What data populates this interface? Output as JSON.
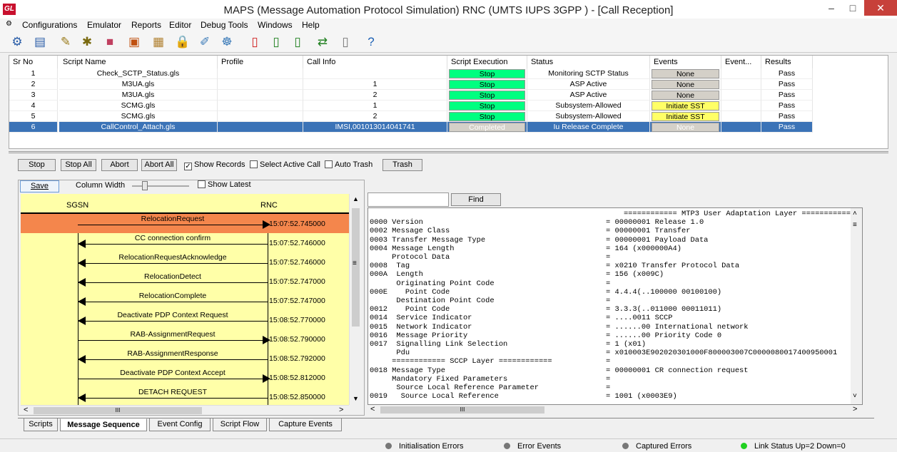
{
  "window": {
    "title": "MAPS (Message Automation Protocol Simulation) RNC (UMTS IUPS 3GPP ) - [Call Reception]",
    "logo": "GL",
    "minimize": "–",
    "maximize": "□",
    "close": "✕"
  },
  "menu": [
    "Configurations",
    "Emulator",
    "Reports",
    "Editor",
    "Debug Tools",
    "Windows",
    "Help"
  ],
  "mdi": [
    "_",
    "🗗",
    "×"
  ],
  "grid": {
    "headers": [
      "Sr No",
      "Script Name",
      "Profile",
      "Call Info",
      "Script Execution",
      "Status",
      "Events",
      "Event...",
      "Results"
    ],
    "rows": [
      {
        "sr": "1",
        "script": "Check_SCTP_Status.gls",
        "profile": "",
        "call": "",
        "exec": "Stop",
        "status": "Monitoring SCTP Status",
        "events": "None",
        "ev2": "",
        "result": "Pass"
      },
      {
        "sr": "2",
        "script": "M3UA.gls",
        "profile": "",
        "call": "1",
        "exec": "Stop",
        "status": "ASP Active",
        "events": "None",
        "ev2": "",
        "result": "Pass"
      },
      {
        "sr": "3",
        "script": "M3UA.gls",
        "profile": "",
        "call": "2",
        "exec": "Stop",
        "status": "ASP Active",
        "events": "None",
        "ev2": "",
        "result": "Pass"
      },
      {
        "sr": "4",
        "script": "SCMG.gls",
        "profile": "",
        "call": "1",
        "exec": "Stop",
        "status": "Subsystem-Allowed",
        "events": "Initiate SST",
        "ev2": "",
        "result": "Pass"
      },
      {
        "sr": "5",
        "script": "SCMG.gls",
        "profile": "",
        "call": "2",
        "exec": "Stop",
        "status": "Subsystem-Allowed",
        "events": "Initiate SST",
        "ev2": "",
        "result": "Pass"
      },
      {
        "sr": "6",
        "script": "CallControl_Attach.gls",
        "profile": "",
        "call": "IMSI,001013014041741",
        "exec": "Completed",
        "status": "Iu Release Complete",
        "events": "None",
        "ev2": "",
        "result": "Pass"
      }
    ]
  },
  "controls": {
    "stop": "Stop",
    "stop_all": "Stop All",
    "abort": "Abort",
    "abort_all": "Abort All",
    "show_records": "Show Records",
    "select_active": "Select Active Call",
    "auto_trash": "Auto Trash",
    "trash": "Trash",
    "check": "✓"
  },
  "seq": {
    "save": "Save",
    "column_width": "Column Width",
    "show_latest": "Show Latest",
    "left": "SGSN",
    "right": "RNC",
    "hscroll": "III",
    "messages": [
      {
        "label": "RelocationRequest",
        "dir": "right",
        "time": "15:07:52.745000",
        "hl": true
      },
      {
        "label": "CC connection confirm",
        "dir": "left",
        "time": "15:07:52.746000"
      },
      {
        "label": "RelocationRequestAcknowledge",
        "dir": "left",
        "time": "15:07:52.746000"
      },
      {
        "label": "RelocationDetect",
        "dir": "left",
        "time": "15:07:52.747000"
      },
      {
        "label": "RelocationComplete",
        "dir": "left",
        "time": "15:07:52.747000"
      },
      {
        "label": "Deactivate PDP Context Request",
        "dir": "left",
        "time": "15:08:52.770000"
      },
      {
        "label": "RAB-AssignmentRequest",
        "dir": "right",
        "time": "15:08:52.790000"
      },
      {
        "label": "RAB-AssignmentResponse",
        "dir": "left",
        "time": "15:08:52.792000"
      },
      {
        "label": "Deactivate PDP Context Accept",
        "dir": "right",
        "time": "15:08:52.812000"
      },
      {
        "label": "DETACH REQUEST",
        "dir": "left",
        "time": "15:08:52.850000"
      }
    ]
  },
  "decode": {
    "find": "Find",
    "search": "",
    "hscroll": "III",
    "lines": [
      [
        "",
        "    ============ MTP3 User Adaptation Layer ============ ="
      ],
      [
        "0000 Version",
        "= 00000001 Release 1.0"
      ],
      [
        "0002 Message Class",
        "= 00000001 Transfer"
      ],
      [
        "0003 Transfer Message Type",
        "= 00000001 Payload Data"
      ],
      [
        "0004 Message Length",
        "= 164 (x000000A4)"
      ],
      [
        "     Protocol Data",
        "="
      ],
      [
        "0008  Tag",
        "= x0210 Transfer Protocol Data"
      ],
      [
        "000A  Length",
        "= 156 (x009C)"
      ],
      [
        "      Originating Point Code",
        "="
      ],
      [
        "000E    Point Code",
        "= 4.4.4(..100000 00100100)"
      ],
      [
        "      Destination Point Code",
        "="
      ],
      [
        "0012    Point Code",
        "= 3.3.3(..011000 00011011)"
      ],
      [
        "0014  Service Indicator",
        "= ....0011 SCCP"
      ],
      [
        "0015  Network Indicator",
        "= ......00 International network"
      ],
      [
        "0016  Message Priority",
        "= ......00 Priority Code 0"
      ],
      [
        "0017  Signalling Link Selection",
        "= 1 (x01)"
      ],
      [
        "      Pdu",
        "= x010003E902020301000F800003007C0000080017400950001"
      ],
      [
        "     ============ SCCP Layer ============",
        "="
      ],
      [
        "0018 Message Type",
        "= 00000001 CR connection request"
      ],
      [
        "     Mandatory Fixed Parameters",
        "="
      ],
      [
        "      Source Local Reference Parameter",
        "="
      ],
      [
        "0019   Source Local Reference",
        "= 1001 (x0003E9)"
      ]
    ]
  },
  "tabs": [
    "Scripts",
    "Message Sequence",
    "Event Config",
    "Script Flow",
    "Capture Events"
  ],
  "status": [
    "Initialisation Errors",
    "Error Events",
    "Captured Errors",
    "Link Status Up=2 Down=0"
  ],
  "colors": {
    "accent": "#3b73b7",
    "running": "#00ff80",
    "event": "#ffff66",
    "seq_bg": "#ffffa8",
    "highlight": "#f4864c"
  }
}
